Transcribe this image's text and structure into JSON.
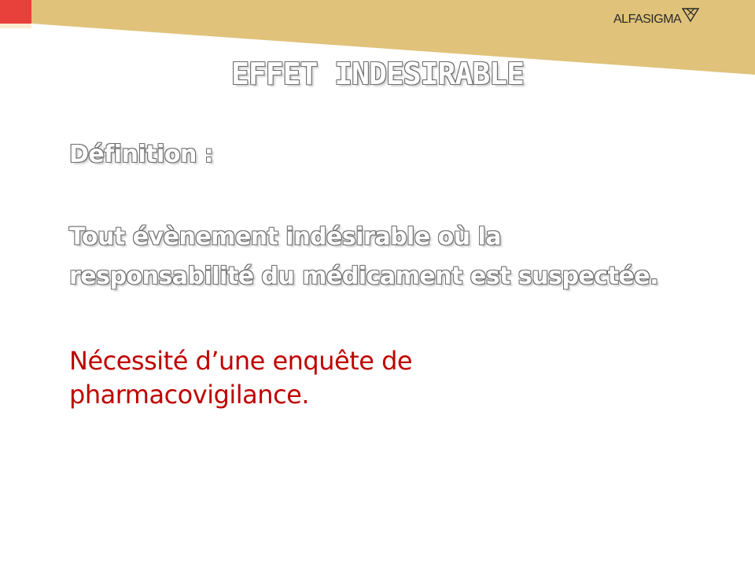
{
  "header": {
    "brand_name": "ALFASIGMA",
    "band_color": "#e0c27a",
    "accent_color": "#e8403a"
  },
  "slide": {
    "title": "EFFET INDESIRABLE",
    "definition_label": "Définition :",
    "definition_line1": "Tout évènement indésirable où la",
    "definition_line2": "responsabilité du médicament est suspectée.",
    "note_line1": "Nécessité d’une enquête de",
    "note_line2": "pharmacovigilance.",
    "note_color": "#c00000"
  }
}
